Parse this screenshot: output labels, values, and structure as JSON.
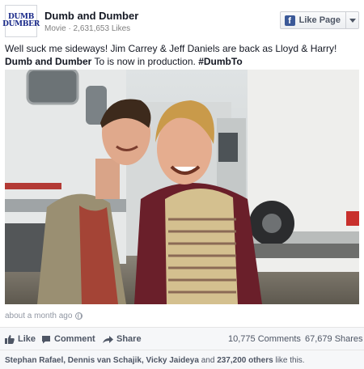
{
  "page": {
    "avatar_line1": "DUMB",
    "avatar_line2": "DUMBER",
    "name": "Dumb and Dumber",
    "meta": "Movie · 2,631,653 Likes",
    "like_button": "Like Page"
  },
  "post": {
    "text_part1": "Well suck me sideways! Jim Carrey & Jeff Daniels are back as Lloyd & Harry! ",
    "text_bold1": "Dumb and Dumber",
    "text_part2": " To is now in production. ",
    "text_bold2": "#DumbTo",
    "timestamp": "about a month ago"
  },
  "actions": {
    "like": "Like",
    "comment": "Comment",
    "share": "Share",
    "comments_count": "10,775 Comments",
    "shares_count": "67,679 Shares"
  },
  "likers": {
    "names": "Stephan Rafael, Dennis van Schajik, Vicky Jaideya",
    "joiner": " and ",
    "others": "237,200 others",
    "suffix": " like this."
  },
  "colors": {
    "brand": "#3b5998",
    "text": "#141823",
    "muted": "#9197a3"
  }
}
